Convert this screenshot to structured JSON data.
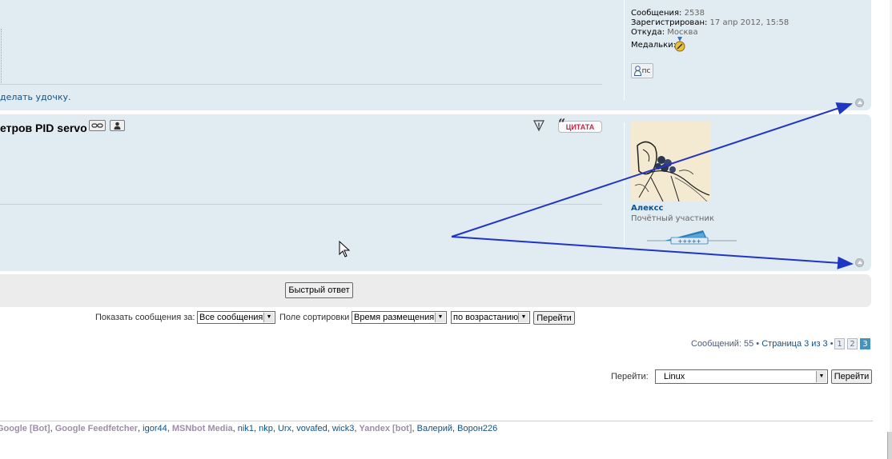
{
  "post1": {
    "signature_text": "делать удочку.",
    "profile": {
      "posts_label": "Сообщения:",
      "posts_value": "2538",
      "registered_label": "Зарегистрирован:",
      "registered_value": "17 апр 2012, 15:58",
      "from_label": "Откуда:",
      "from_value": "Москва",
      "medals_label": "Медальки:"
    },
    "pm_label": "ПС"
  },
  "post2": {
    "title": "етров PID servo",
    "quote_label": "ЦИТАТА",
    "author": {
      "username": "Алексс",
      "rank": "Почётный участник"
    }
  },
  "quick_reply_label": "Быстрый ответ",
  "sort": {
    "show_label": "Показать сообщения за:",
    "show_value": "Все сообщения",
    "sort_label": "Поле сортировки",
    "sort_value": "Время размещения",
    "order_value": "по возрастанию",
    "go_label": "Перейти"
  },
  "pagination": {
    "count_text": "Сообщений: 55 •",
    "page_text": "Страница 3 из 3",
    "sep": "•",
    "pages": [
      "1",
      "2",
      "3"
    ],
    "current": "3"
  },
  "jump": {
    "label": "Перейти:",
    "value": "Linux",
    "go_label": "Перейти"
  },
  "online": [
    {
      "name": "Google [Bot]",
      "type": "bot"
    },
    {
      "name": "Google Feedfetcher",
      "type": "bot"
    },
    {
      "name": "igor44",
      "type": "user"
    },
    {
      "name": "MSNbot Media",
      "type": "bot"
    },
    {
      "name": "nik1",
      "type": "user"
    },
    {
      "name": "nkp",
      "type": "user"
    },
    {
      "name": "Urx",
      "type": "user"
    },
    {
      "name": "vovafed",
      "type": "user"
    },
    {
      "name": "wick3",
      "type": "user"
    },
    {
      "name": "Yandex [bot]",
      "type": "bot"
    },
    {
      "name": "Валерий",
      "type": "user"
    },
    {
      "name": "Ворон226",
      "type": "user"
    }
  ],
  "colors": {
    "post_bg": "#e1ebf2",
    "link": "#105289",
    "bot": "#9e8da7",
    "annotation_arrow": "#1f35c4"
  }
}
